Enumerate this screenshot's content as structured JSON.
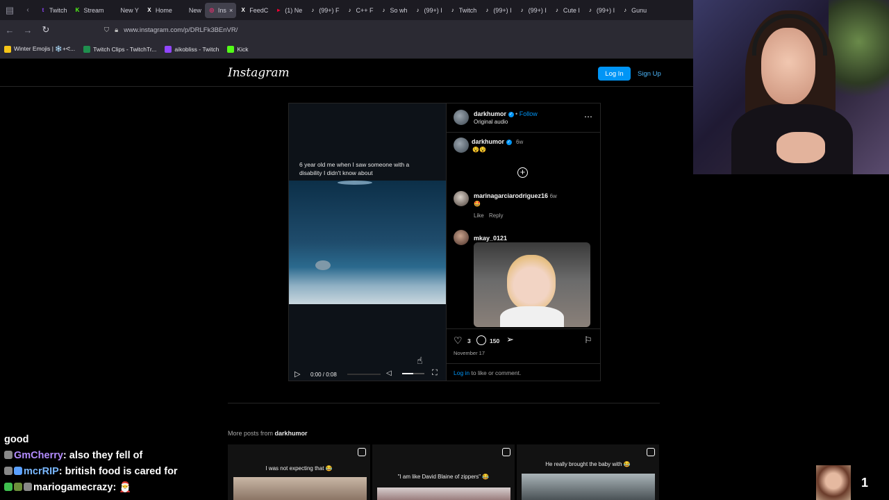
{
  "browser": {
    "tabs": [
      {
        "label": "Twitch",
        "color": "#9146ff",
        "glyph": "t"
      },
      {
        "label": "Stream",
        "color": "#53fc18",
        "glyph": "K"
      },
      {
        "label": "New Y",
        "color": "#f5c518",
        "glyph": ""
      },
      {
        "label": "Home",
        "color": "#ffffff",
        "glyph": "X"
      },
      {
        "label": "New",
        "color": "#ff7139",
        "glyph": ""
      },
      {
        "label": "Ins",
        "color": "#e1306c",
        "glyph": "◎",
        "active": true
      },
      {
        "label": "FeedC",
        "color": "#ffffff",
        "glyph": "X"
      },
      {
        "label": "(1) Ne",
        "color": "#ff0033",
        "glyph": "▸"
      },
      {
        "label": "(99+) F",
        "color": "#ffffff",
        "glyph": "♪"
      },
      {
        "label": "C++ F",
        "color": "#ffffff",
        "glyph": "♪"
      },
      {
        "label": "So wh",
        "color": "#ffffff",
        "glyph": "♪"
      },
      {
        "label": "(99+) I",
        "color": "#ffffff",
        "glyph": "♪"
      },
      {
        "label": "Twitch",
        "color": "#ffffff",
        "glyph": "♪"
      },
      {
        "label": "(99+) I",
        "color": "#ffffff",
        "glyph": "♪"
      },
      {
        "label": "(99+) I",
        "color": "#ffffff",
        "glyph": "♪"
      },
      {
        "label": "Cute I",
        "color": "#ffffff",
        "glyph": "♪"
      },
      {
        "label": "(99+) I",
        "color": "#ffffff",
        "glyph": "♪"
      },
      {
        "label": "Gunu",
        "color": "#ffffff",
        "glyph": "♪"
      }
    ],
    "url": "www.instagram.com/p/DRLFk3BEnVR/",
    "bookmarks": [
      {
        "label": "Winter Emojis | ❄️+ᕙ...",
        "color": "#f5c518"
      },
      {
        "label": "Twitch Clips - TwitchTr...",
        "color": "#1f8f4e"
      },
      {
        "label": "aikobliss - Twitch",
        "color": "#9146ff"
      },
      {
        "label": "Kick",
        "color": "#53fc18"
      }
    ]
  },
  "instagram": {
    "logo": "Instagram",
    "login_label": "Log In",
    "signup_label": "Sign Up",
    "post": {
      "video_caption": "6 year old me when I saw someone with a disability I didn't know about",
      "time_display": "0:00 / 0:08",
      "author": "darkhumor",
      "follow_label": "Follow",
      "audio_label": "Original audio",
      "caption_author": "darkhumor",
      "caption_age": "6w",
      "caption_emojis": "😵😵",
      "comments": [
        {
          "user": "marinagarciarodriguez16",
          "age": "6w",
          "text": "🤩",
          "like": "Like",
          "reply": "Reply"
        },
        {
          "user": "mkay_0121"
        }
      ],
      "like_count": "3",
      "comment_count": "150",
      "date": "November 17",
      "login_prompt_link": "Log in",
      "login_prompt_rest": " to like or comment."
    },
    "more_posts_prefix": "More posts from ",
    "more_posts_author": "darkhumor",
    "thumbnails": [
      {
        "caption": "I was not expecting that 😂"
      },
      {
        "caption": "\"I am like David Blaine of zippers\" 😂"
      },
      {
        "caption": "He really brought the baby with 😂"
      }
    ]
  },
  "stream_overlay": {
    "chat": [
      {
        "user": "",
        "message": "good"
      },
      {
        "user": "GmCherry",
        "message": ": also they fell of"
      },
      {
        "user": "mcrRIP",
        "message": ": british food is cared for"
      },
      {
        "user": "mariogamecrazy",
        "message": ": 🎅"
      }
    ],
    "viewer_count": "1"
  }
}
